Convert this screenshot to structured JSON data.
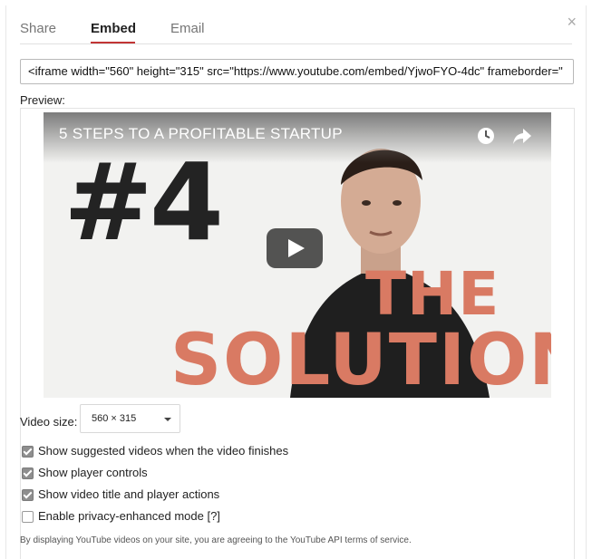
{
  "tabs": [
    {
      "label": "Share"
    },
    {
      "label": "Embed"
    },
    {
      "label": "Email"
    }
  ],
  "close_icon": "×",
  "embed_code": "<iframe width=\"560\" height=\"315\" src=\"https://www.youtube.com/embed/YjwoFYO-4dc\" frameborder=\"",
  "preview_label": "Preview:",
  "video": {
    "title": "5 STEPS TO A PROFITABLE STARTUP",
    "thumbnail_text_number": "#4",
    "thumbnail_text_the": "THE",
    "thumbnail_text_solution": "SOLUTION",
    "accent_color": "#d97a63",
    "icons": [
      "clock-icon",
      "share-arrow-icon",
      "play-icon"
    ]
  },
  "video_size": {
    "label": "Video size:",
    "selected": "560 × 315"
  },
  "options": [
    {
      "label": "Show suggested videos when the video finishes",
      "checked": true
    },
    {
      "label": "Show player controls",
      "checked": true
    },
    {
      "label": "Show video title and player actions",
      "checked": true
    },
    {
      "label": "Enable privacy-enhanced mode",
      "help": "[?]",
      "checked": false
    }
  ],
  "terms": "By displaying YouTube videos on your site, you are agreeing to the YouTube API terms of service."
}
